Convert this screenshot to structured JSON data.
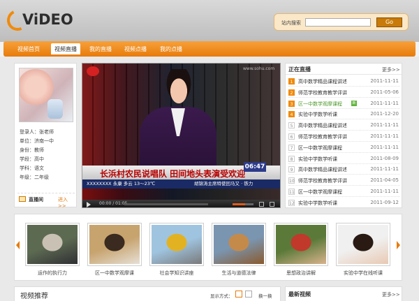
{
  "header": {
    "logo_text": "ViDEO",
    "search_label": "站内搜索",
    "search_value": "",
    "search_button": "Go"
  },
  "nav": {
    "items": [
      "视频首页",
      "视频直播",
      "我的直播",
      "视频点播",
      "我的点播"
    ],
    "active_index": 1
  },
  "profile": {
    "login": "登录人：张老师",
    "unit": "单位：济南一中",
    "identity": "身份：教师",
    "stage": "学段：高中",
    "subject": "学科：语文",
    "grade": "年级：二年级",
    "live_room_label": "直播间",
    "enter_label": "进入>>"
  },
  "player": {
    "channel_url": "www.sohu.com",
    "headline": "长浜村农民说唱队 田间地头表演受欢迎",
    "clock": "06:47",
    "sub_ticker_left": "XXXXXXXX  永康  多云  13～23℃",
    "sub_ticker_right": "胡锦涛主席特使回马又 · 铁力",
    "time": "00:00 / 01:05",
    "volume_level": 0.6
  },
  "live_list": {
    "title": "正在直播",
    "more": "更多>>",
    "rows": [
      {
        "num": "1",
        "title": "高中数学精品课程讲述",
        "date": "2011-11-11",
        "hot": true,
        "green": false,
        "badge": ""
      },
      {
        "num": "2",
        "title": "师范学校教育教学评讲",
        "date": "2011-05-06",
        "hot": true,
        "green": false,
        "badge": ""
      },
      {
        "num": "3",
        "title": "区一中数学观摩课程",
        "date": "2011-11-11",
        "hot": true,
        "green": true,
        "badge": "新"
      },
      {
        "num": "4",
        "title": "实验中学数学听课",
        "date": "2011-12-20",
        "hot": true,
        "green": false,
        "badge": ""
      },
      {
        "num": "5",
        "title": "高中数学精品课程讲述",
        "date": "2011-11-11",
        "hot": false,
        "green": false,
        "badge": ""
      },
      {
        "num": "6",
        "title": "师范学校教育教学评讲",
        "date": "2011-11-11",
        "hot": false,
        "green": false,
        "badge": ""
      },
      {
        "num": "7",
        "title": "区一中数学观摩课程",
        "date": "2011-11-11",
        "hot": false,
        "green": false,
        "badge": ""
      },
      {
        "num": "8",
        "title": "实验中学数学听课",
        "date": "2011-08-09",
        "hot": false,
        "green": false,
        "badge": ""
      },
      {
        "num": "9",
        "title": "高中数学精品课程讲述",
        "date": "2011-11-11",
        "hot": false,
        "green": false,
        "badge": ""
      },
      {
        "num": "10",
        "title": "师范学校教育教学评讲",
        "date": "2011-04-05",
        "hot": false,
        "green": false,
        "badge": ""
      },
      {
        "num": "11",
        "title": "区一中数学观摩课程",
        "date": "2011-11-11",
        "hot": false,
        "green": false,
        "badge": ""
      },
      {
        "num": "12",
        "title": "实验中学数学听课",
        "date": "2011-09-12",
        "hot": false,
        "green": false,
        "badge": ""
      }
    ]
  },
  "carousel": {
    "items": [
      {
        "caption": "运作的执行力",
        "colors": [
          "#5d6a52",
          "#c9c1b3",
          "#2f2f33"
        ]
      },
      {
        "caption": "区一中数学观摩课",
        "colors": [
          "#c7a36e",
          "#3a2a1f",
          "#e6e0d6"
        ]
      },
      {
        "caption": "社会学知识讲座",
        "colors": [
          "#9fc4e0",
          "#e2b223",
          "#7a7a7a"
        ]
      },
      {
        "caption": "生活与道德法律",
        "colors": [
          "#7a95b0",
          "#c48a4a",
          "#8a5a2e"
        ]
      },
      {
        "caption": "思想政治讲解",
        "colors": [
          "#5b7a3a",
          "#c0392b",
          "#d9b38c"
        ]
      },
      {
        "caption": "实验中学在线听课",
        "colors": [
          "#f0f0f0",
          "#2a1a14",
          "#e8c9b3"
        ]
      }
    ]
  },
  "recommend": {
    "title": "视频推荐",
    "display_mode_label": "显示方式：",
    "switch_label": "换一换"
  },
  "latest": {
    "title": "最新视频",
    "more": "更多>>"
  },
  "colors": {
    "accent": "#e77b0b",
    "headline_red": "#b80000",
    "ticker_blue": "#1a2a64"
  }
}
